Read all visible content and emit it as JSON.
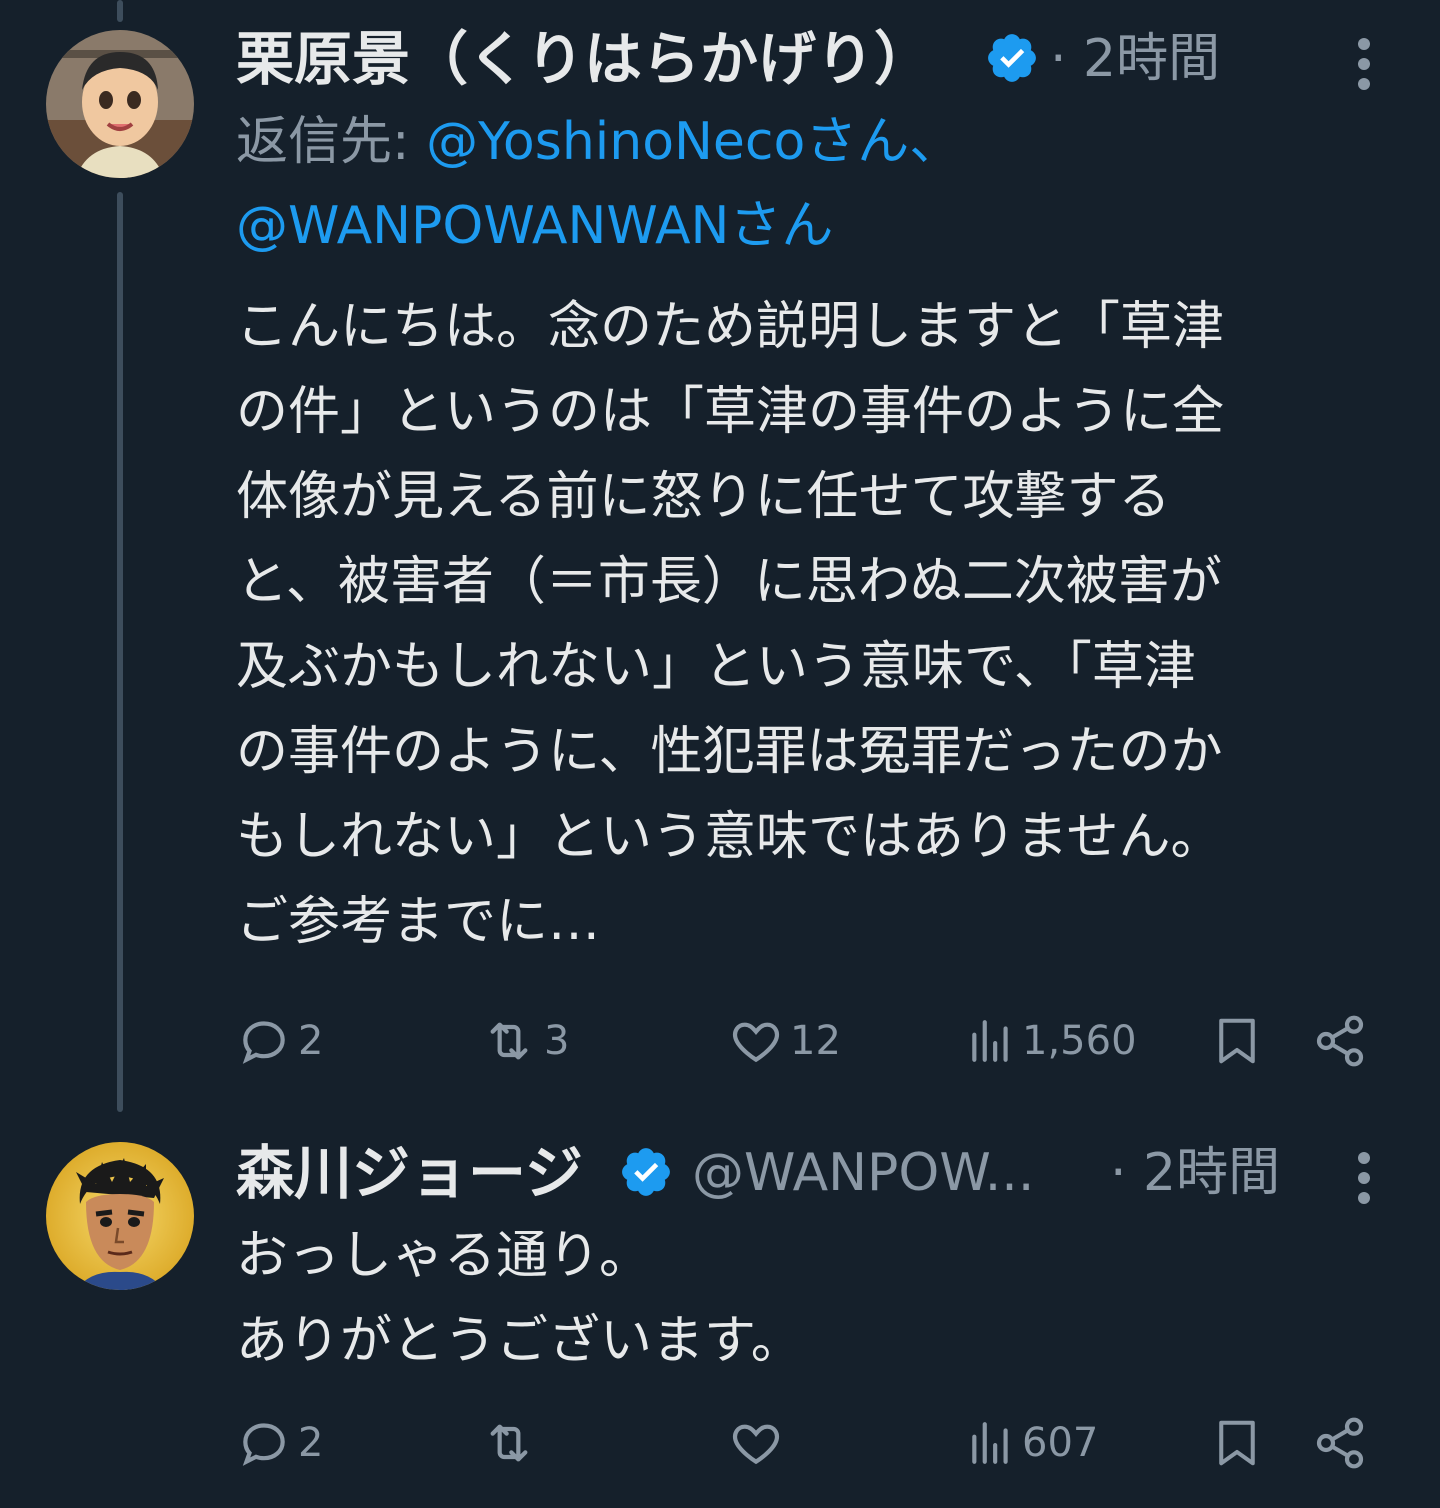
{
  "tweet1": {
    "display_name": "栗原景（くりはらかげり）",
    "time": "· 2時間",
    "reply_prefix": "返信先: ",
    "reply_mention_1": "@YoshinoNecoさん、",
    "reply_mention_2": "@WANPOWANWANさん",
    "text": "こんにちは。念のため説明しますと「草津\nの件」というのは「草津の事件のように全\n体像が見える前に怒りに任せて攻撃する\nと、被害者（＝市長）に思わぬ二次被害が\n及ぶかもしれない」という意味で、「草津\nの事件のように、性犯罪は冤罪だったのか\nもしれない」という意味ではありません。\nご参考までに…",
    "stats": {
      "replies": "2",
      "retweets": "3",
      "likes": "12",
      "views": "1,560"
    }
  },
  "tweet2": {
    "display_name": "森川ジョージ",
    "handle": "@WANPOW...",
    "time": "· 2時間",
    "text": "おっしゃる通り。\nありがとうございます。",
    "stats": {
      "replies": "2",
      "retweets": "",
      "likes": "",
      "views": "607"
    }
  },
  "colors": {
    "background": "#15202b",
    "accent": "#1d9bf0",
    "muted": "#8b98a5",
    "text": "#e7e9ea",
    "thread_line": "#3d4d5c"
  },
  "icons": [
    "verified-icon",
    "more-icon",
    "reply-icon",
    "retweet-icon",
    "like-icon",
    "views-icon",
    "bookmark-icon",
    "share-icon"
  ]
}
